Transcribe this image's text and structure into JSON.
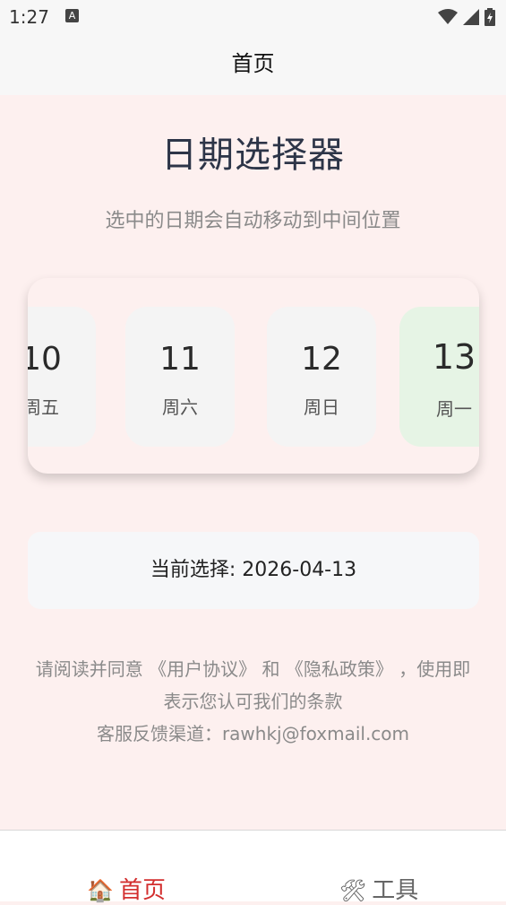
{
  "status_bar": {
    "time": "1:27",
    "notification_icon": "A"
  },
  "app_bar": {
    "title": "首页"
  },
  "page": {
    "title": "日期选择器",
    "subtitle": "选中的日期会自动移动到中间位置"
  },
  "date_picker": {
    "days": [
      {
        "date": "10",
        "weekday": "周五",
        "selected": false
      },
      {
        "date": "11",
        "weekday": "周六",
        "selected": false
      },
      {
        "date": "12",
        "weekday": "周日",
        "selected": false
      },
      {
        "date": "13",
        "weekday": "周一",
        "selected": true
      }
    ]
  },
  "selection": {
    "text": "当前选择: 2026-04-13"
  },
  "terms": {
    "line1": "请阅读并同意 《用户协议》 和 《隐私政策》 ，使用即表示您认可我们的条款",
    "line2": "客服反馈渠道：rawhkj@foxmail.com"
  },
  "bottom_nav": {
    "items": [
      {
        "label": "首页",
        "icon": "house-icon",
        "active": true
      },
      {
        "label": "工具",
        "icon": "tools-icon",
        "active": false
      }
    ]
  },
  "colors": {
    "background": "#fdf0ef",
    "selected_day": "#e6f4e5",
    "active_nav": "#d32f2f"
  }
}
